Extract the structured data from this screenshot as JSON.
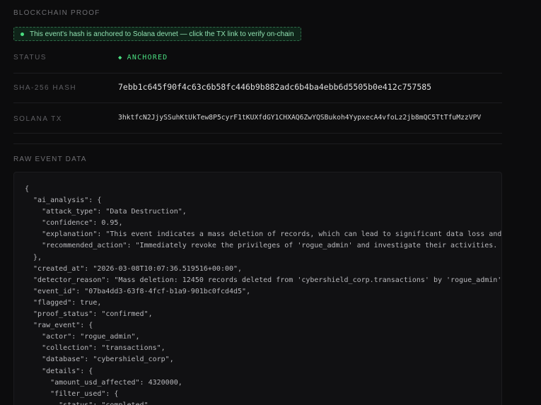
{
  "proof": {
    "section_title": "BLOCKCHAIN PROOF",
    "banner_text": "This event's hash is anchored to Solana devnet — click the TX link to verify on-chain",
    "status_label": "STATUS",
    "status_value": "ANCHORED",
    "hash_label": "SHA-256 HASH",
    "hash_value": "7ebb1c645f90f4c63c6b58fc446b9b882adc6b4ba4ebb6d5505b0e412c757585",
    "tx_label": "SOLANA TX",
    "tx_value": "3hktfcN2JjySSuhKtUkTew8P5cyrF1tKUXfdGY1CHXAQ6ZwYQSBukoh4YypxecA4vfoLz2jb8mQC5TtTfuMzzVPV"
  },
  "raw": {
    "section_title": "RAW EVENT DATA",
    "lines": [
      "{",
      "  \"ai_analysis\": {",
      "    \"attack_type\": \"Data Destruction\",",
      "    \"confidence\": 0.95,",
      "    \"explanation\": \"This event indicates a mass deletion of records, which can lead to significant data loss and c",
      "    \"recommended_action\": \"Immediately revoke the privileges of 'rogue_admin' and investigate their activities. Re",
      "  },",
      "  \"created_at\": \"2026-03-08T10:07:36.519516+00:00\",",
      "  \"detector_reason\": \"Mass deletion: 12450 records deleted from 'cybershield_corp.transactions' by 'rogue_admin'\",",
      "  \"event_id\": \"07ba4dd3-63f8-4fcf-b1a9-901bc0fcd4d5\",",
      "  \"flagged\": true,",
      "  \"proof_status\": \"confirmed\",",
      "  \"raw_event\": {",
      "    \"actor\": \"rogue_admin\",",
      "    \"collection\": \"transactions\",",
      "    \"database\": \"cybershield_corp\",",
      "    \"details\": {",
      "      \"amount_usd_affected\": 4320000,",
      "      \"filter_used\": {",
      "        \"status\": \"completed\""
    ]
  },
  "colors": {
    "accent_green": "#4ade80",
    "background": "#0c0c0d"
  }
}
